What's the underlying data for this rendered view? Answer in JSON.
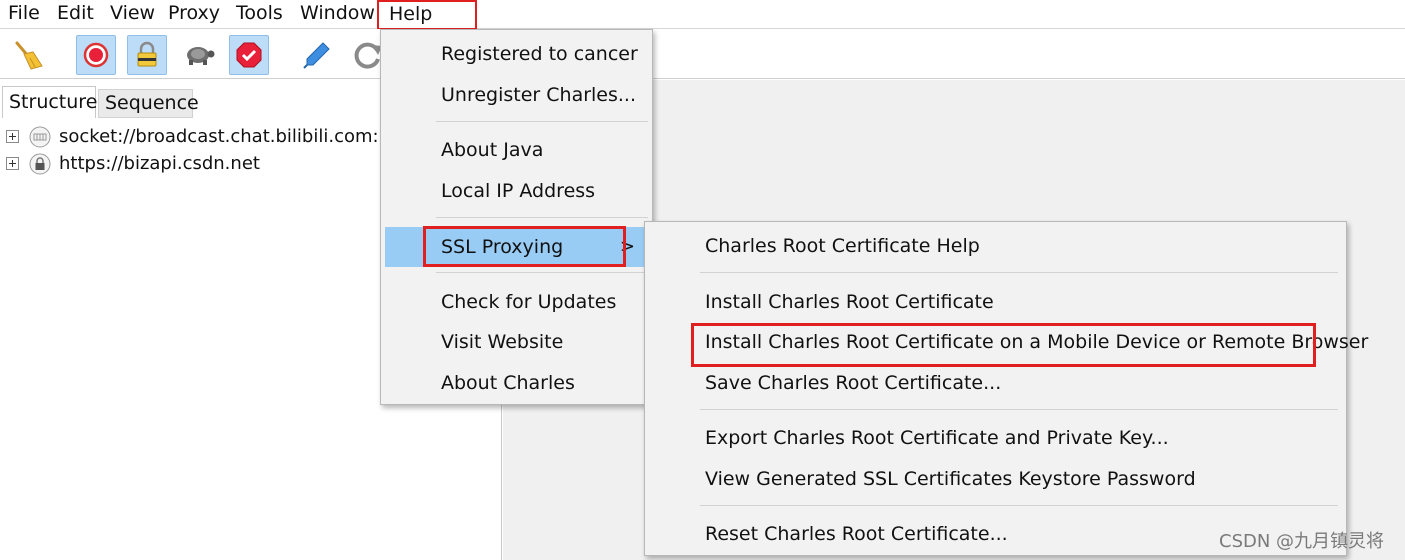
{
  "menubar": {
    "items": [
      "File",
      "Edit",
      "View",
      "Proxy",
      "Tools",
      "Window",
      "Help"
    ]
  },
  "toolbar": {
    "buttons": [
      {
        "icon": "broom-icon",
        "active": false
      },
      {
        "icon": "record-icon",
        "active": true
      },
      {
        "icon": "ssl-lock-icon",
        "active": true
      },
      {
        "icon": "turtle-throttle-icon",
        "active": false
      },
      {
        "icon": "breakpoint-icon",
        "active": true
      },
      {
        "icon": "pen-compose-icon",
        "active": false
      },
      {
        "icon": "refresh-icon",
        "active": false
      }
    ]
  },
  "left_panel": {
    "tabs": [
      "Structure",
      "Sequence"
    ],
    "tree": [
      {
        "icon": "websocket-icon",
        "label": "socket://broadcast.chat.bilibili.com:7826"
      },
      {
        "icon": "lock-icon",
        "label": "https://bizapi.csdn.net"
      }
    ]
  },
  "help_menu": {
    "items": [
      "Registered to cancer",
      "Unregister Charles...",
      "About Java",
      "Local IP Address",
      "SSL Proxying",
      "Check for Updates",
      "Visit Website",
      "About Charles"
    ],
    "submenu_arrow": ">"
  },
  "ssl_submenu": {
    "items": [
      "Charles Root Certificate Help",
      "Install Charles Root Certificate",
      "Install Charles Root Certificate on a Mobile Device or Remote Browser",
      "Save Charles Root Certificate...",
      "Export Charles Root Certificate and Private Key...",
      "View Generated SSL Certificates Keystore Password",
      "Reset Charles Root Certificate..."
    ]
  },
  "watermark": "CSDN @九月镇灵将",
  "colors": {
    "highlight": "#99ccf5",
    "annotation_red": "#e0201e",
    "toolbar_active": "#bcdcf8"
  }
}
